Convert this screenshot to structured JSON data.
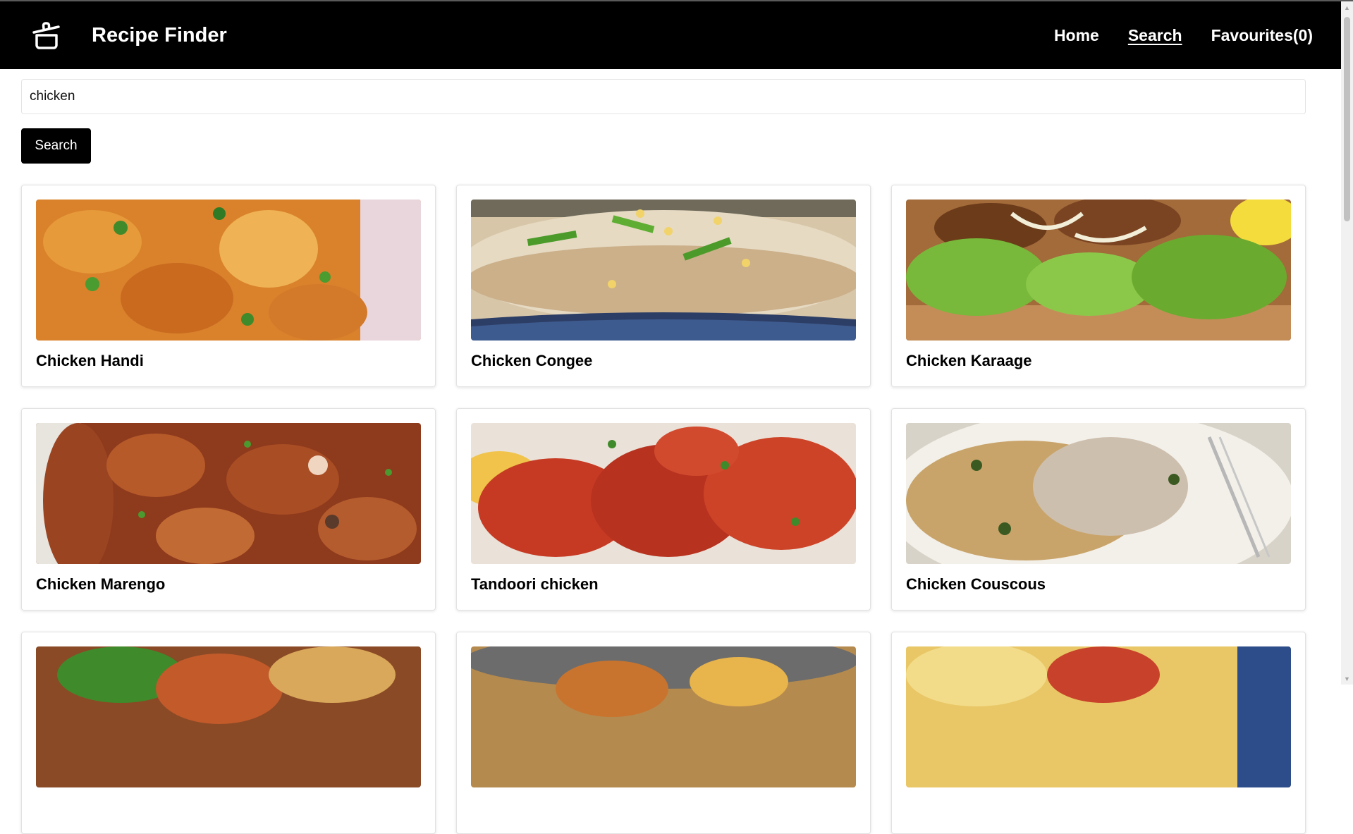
{
  "header": {
    "app_title": "Recipe Finder",
    "icon": "cooking-pot-icon",
    "nav": [
      {
        "label": "Home"
      },
      {
        "label": "Search"
      },
      {
        "label": "Favourites(0)"
      }
    ]
  },
  "search": {
    "value": "chicken",
    "button_label": "Search"
  },
  "results": [
    {
      "title": "Chicken Handi"
    },
    {
      "title": "Chicken Congee"
    },
    {
      "title": "Chicken Karaage"
    },
    {
      "title": "Chicken Marengo"
    },
    {
      "title": "Tandoori chicken"
    },
    {
      "title": "Chicken Couscous"
    },
    {
      "title": ""
    },
    {
      "title": ""
    },
    {
      "title": ""
    }
  ],
  "colors": {
    "navbar_bg": "#000000",
    "button_bg": "#000000",
    "accent_text": "#ffffff"
  }
}
